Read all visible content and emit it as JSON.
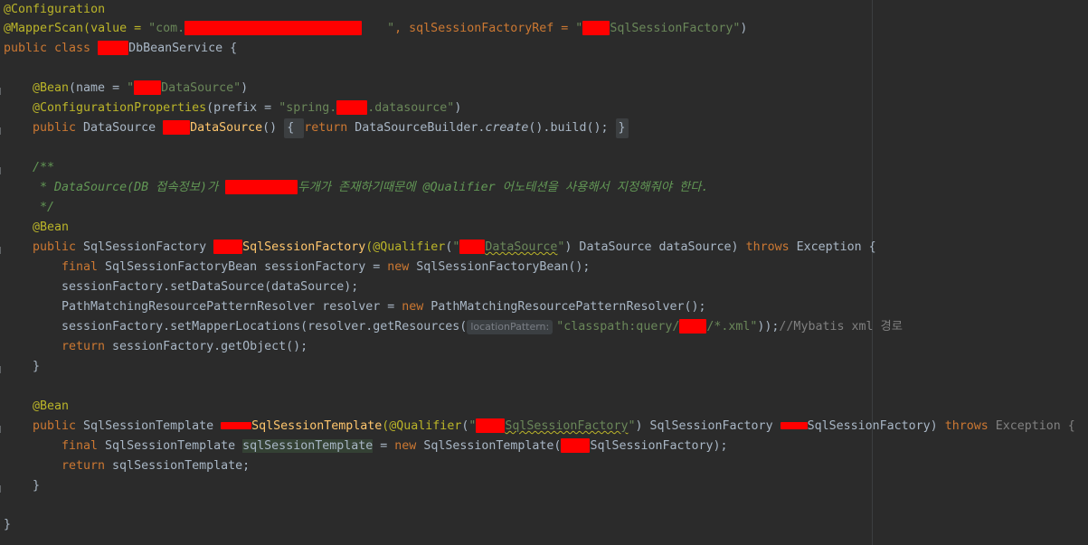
{
  "editor": {
    "l1": "@Configuration",
    "l2a": "@MapperScan(value = ",
    "l2b": "\"com.",
    "l2c": "\"",
    "l2d": ", sqlSessionFactoryRef = ",
    "l2e": "\"",
    "l2f": "SqlSessionFactory\"",
    "l2g": ")",
    "l3a": "public class ",
    "l3b": "DbBeanService {",
    "l5a": "@Bean",
    "l5b": "(name = ",
    "l5c": "\"",
    "l5d": "DataSource\"",
    "l5e": ")",
    "l6a": "@ConfigurationProperties",
    "l6b": "(prefix = ",
    "l6c": "\"spring.",
    "l6d": ".datasource\"",
    "l6e": ")",
    "l7a": "public ",
    "l7b": "DataSource ",
    "l7c": "DataSource",
    "l7d": "() ",
    "l7e": "{ ",
    "l7f": "return ",
    "l7g": "DataSourceBuilder.",
    "l7h": "create",
    "l7i": "().build(); ",
    "l7j": "}",
    "l9": "/**",
    "l10a": " * DataSource(DB 접속정보)가 ",
    "l10b": "두개가 존재하기때문에 @Qualifier 어노테션을 사용해서 지정해줘야 한다.",
    "l11": " */",
    "l12": "@Bean",
    "l13a": "public ",
    "l13b": "SqlSessionFactory ",
    "l13c": "SqlSessionFactory",
    "l13d": "(@Qualifier",
    "l13e": "(",
    "l13f": "\"",
    "l13g": "DataSource",
    "l13h": "\"",
    "l13i": ") DataSource dataSource) ",
    "l13j": "throws ",
    "l13k": "Exception {",
    "l14a": "final ",
    "l14b": "SqlSessionFactoryBean sessionFactory = ",
    "l14c": "new ",
    "l14d": "SqlSessionFactoryBean();",
    "l15": "sessionFactory.setDataSource(dataSource);",
    "l16a": "PathMatchingResourcePatternResolver resolver = ",
    "l16b": "new ",
    "l16c": "PathMatchingResourcePatternResolver();",
    "l17a": "sessionFactory.setMapperLocations(resolver.getResources(",
    "l17hint": "locationPattern:",
    "l17b": "\"classpath:query/",
    "l17c": "/*.xml\"",
    "l17d": "));",
    "l17e": "//Mybatis xml 경로",
    "l18a": "return ",
    "l18b": "sessionFactory.getObject();",
    "l19": "}",
    "l21": "@Bean",
    "l22a": "public ",
    "l22b": "SqlSessionTemplate ",
    "l22c": "SqlSessionTemplate",
    "l22d": "(@Qualifier",
    "l22e": "(",
    "l22f": "\"",
    "l22g": "SqlSessionFactory",
    "l22h": "\"",
    "l22i": ") SqlSessionFactory ",
    "l22j": "SqlSessionFactory) ",
    "l22k": "throws ",
    "l22l": "Exception {",
    "l23a": "final ",
    "l23b": "SqlSessionTemplate ",
    "l23c": "sqlSessionTemplate",
    "l23d": " = ",
    "l23e": "new ",
    "l23f": "SqlSessionTemplate(",
    "l23g": "SqlSessionFactory);",
    "l24a": "return ",
    "l24b": "sqlSessionTemplate;",
    "l25": "}",
    "l27": "}"
  }
}
